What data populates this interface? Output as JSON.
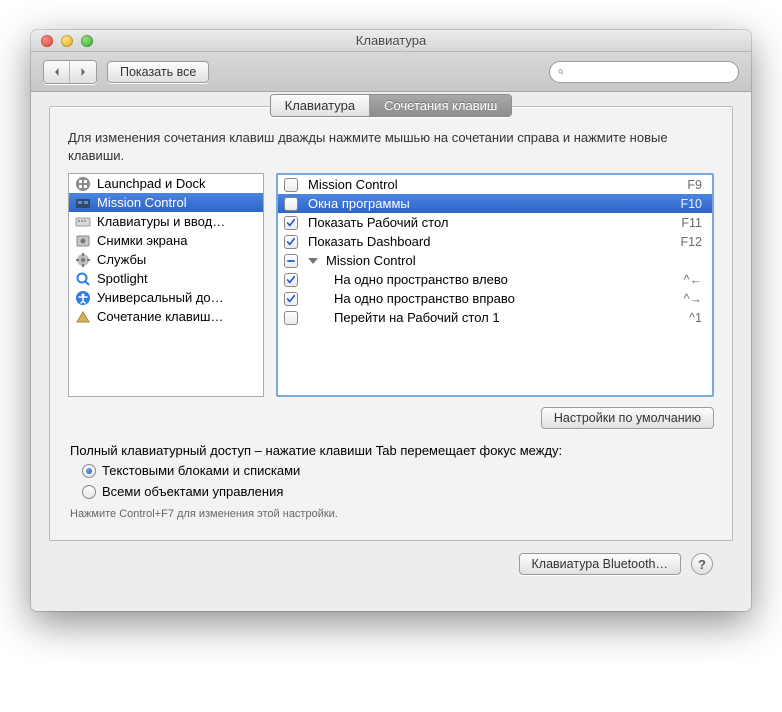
{
  "window": {
    "title": "Клавиатура"
  },
  "toolbar": {
    "show_all": "Показать все"
  },
  "tabs": {
    "keyboard": "Клавиатура",
    "shortcuts": "Сочетания клавиш"
  },
  "instruction": "Для изменения сочетания клавиш дважды нажмите мышью на сочетании справа и нажмите новые клавиши.",
  "categories": [
    {
      "label": "Launchpad и Dock",
      "icon": "launchpad",
      "selected": false
    },
    {
      "label": "Mission Control",
      "icon": "mission",
      "selected": true
    },
    {
      "label": "Клавиатуры и ввод…",
      "icon": "keyboard",
      "selected": false
    },
    {
      "label": "Снимки экрана",
      "icon": "screenshot",
      "selected": false
    },
    {
      "label": "Службы",
      "icon": "services",
      "selected": false
    },
    {
      "label": "Spotlight",
      "icon": "spotlight",
      "selected": false
    },
    {
      "label": "Универсальный до…",
      "icon": "accessibility",
      "selected": false
    },
    {
      "label": "Сочетание клавиш…",
      "icon": "appshortcuts",
      "selected": false
    }
  ],
  "shortcuts": [
    {
      "checked": false,
      "label": "Mission Control",
      "key": "F9",
      "indent": 0,
      "selected": false,
      "group": false
    },
    {
      "checked": false,
      "label": "Окна программы",
      "key": "F10",
      "indent": 0,
      "selected": true,
      "group": false
    },
    {
      "checked": true,
      "label": "Показать Рабочий стол",
      "key": "F11",
      "indent": 0,
      "selected": false,
      "group": false
    },
    {
      "checked": true,
      "label": "Показать Dashboard",
      "key": "F12",
      "indent": 0,
      "selected": false,
      "group": false
    },
    {
      "checked": "mixed",
      "label": "Mission Control",
      "key": "",
      "indent": 0,
      "selected": false,
      "group": true
    },
    {
      "checked": true,
      "label": "На одно пространство влево",
      "key": "^←",
      "indent": 1,
      "selected": false,
      "group": false
    },
    {
      "checked": true,
      "label": "На одно пространство вправо",
      "key": "^→",
      "indent": 1,
      "selected": false,
      "group": false
    },
    {
      "checked": false,
      "label": "Перейти на Рабочий стол 1",
      "key": "^1",
      "indent": 1,
      "selected": false,
      "group": false
    }
  ],
  "defaults_button": "Настройки по умолчанию",
  "full_access_label": "Полный клавиатурный доступ – нажатие клавиши Tab перемещает фокус между:",
  "radios": {
    "text_lists": "Текстовыми блоками и списками",
    "all_controls": "Всеми объектами управления",
    "selected": "text_lists"
  },
  "hint": "Нажмите Control+F7 для изменения этой настройки.",
  "footer": {
    "bluetooth": "Клавиатура Bluetooth…"
  }
}
